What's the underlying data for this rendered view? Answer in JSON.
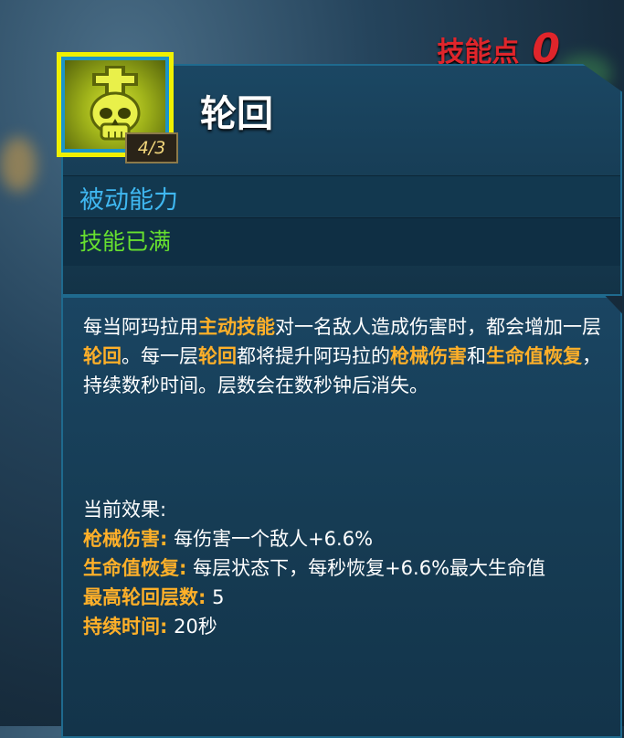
{
  "skill_points": {
    "label": "技能点",
    "value": "0"
  },
  "skill": {
    "name": "轮回",
    "rank": "4/3",
    "type": "被动能力",
    "status": "技能已满"
  },
  "description": {
    "p1": "每当阿玛拉用",
    "k1": "主动技能",
    "p2": "对一名敌人造成伤害时，都会增加一层",
    "k2": "轮回",
    "p3": "。每一层",
    "k3": "轮回",
    "p4": "都将提升阿玛拉的",
    "k4": "枪械伤害",
    "p5": "和",
    "k5": "生命值恢复",
    "p6": "，持续数秒时间。层数会在数秒钟后消失。"
  },
  "effects": {
    "heading": "当前效果:",
    "items": [
      {
        "label": "枪械伤害:",
        "value": " 每伤害一个敌人+6.6%"
      },
      {
        "label": "生命值恢复:",
        "value": " 每层状态下，每秒恢复+6.6%最大生命值"
      },
      {
        "label": "最高轮回层数:",
        "value": " 5"
      },
      {
        "label": "持续时间:",
        "value": " 20秒"
      }
    ]
  },
  "colors": {
    "accent_red": "#e0252b",
    "highlight_orange": "#ffb029",
    "type_blue": "#3fb7f0",
    "status_green": "#67e02f",
    "icon_border_yellow": "#f0f000"
  }
}
